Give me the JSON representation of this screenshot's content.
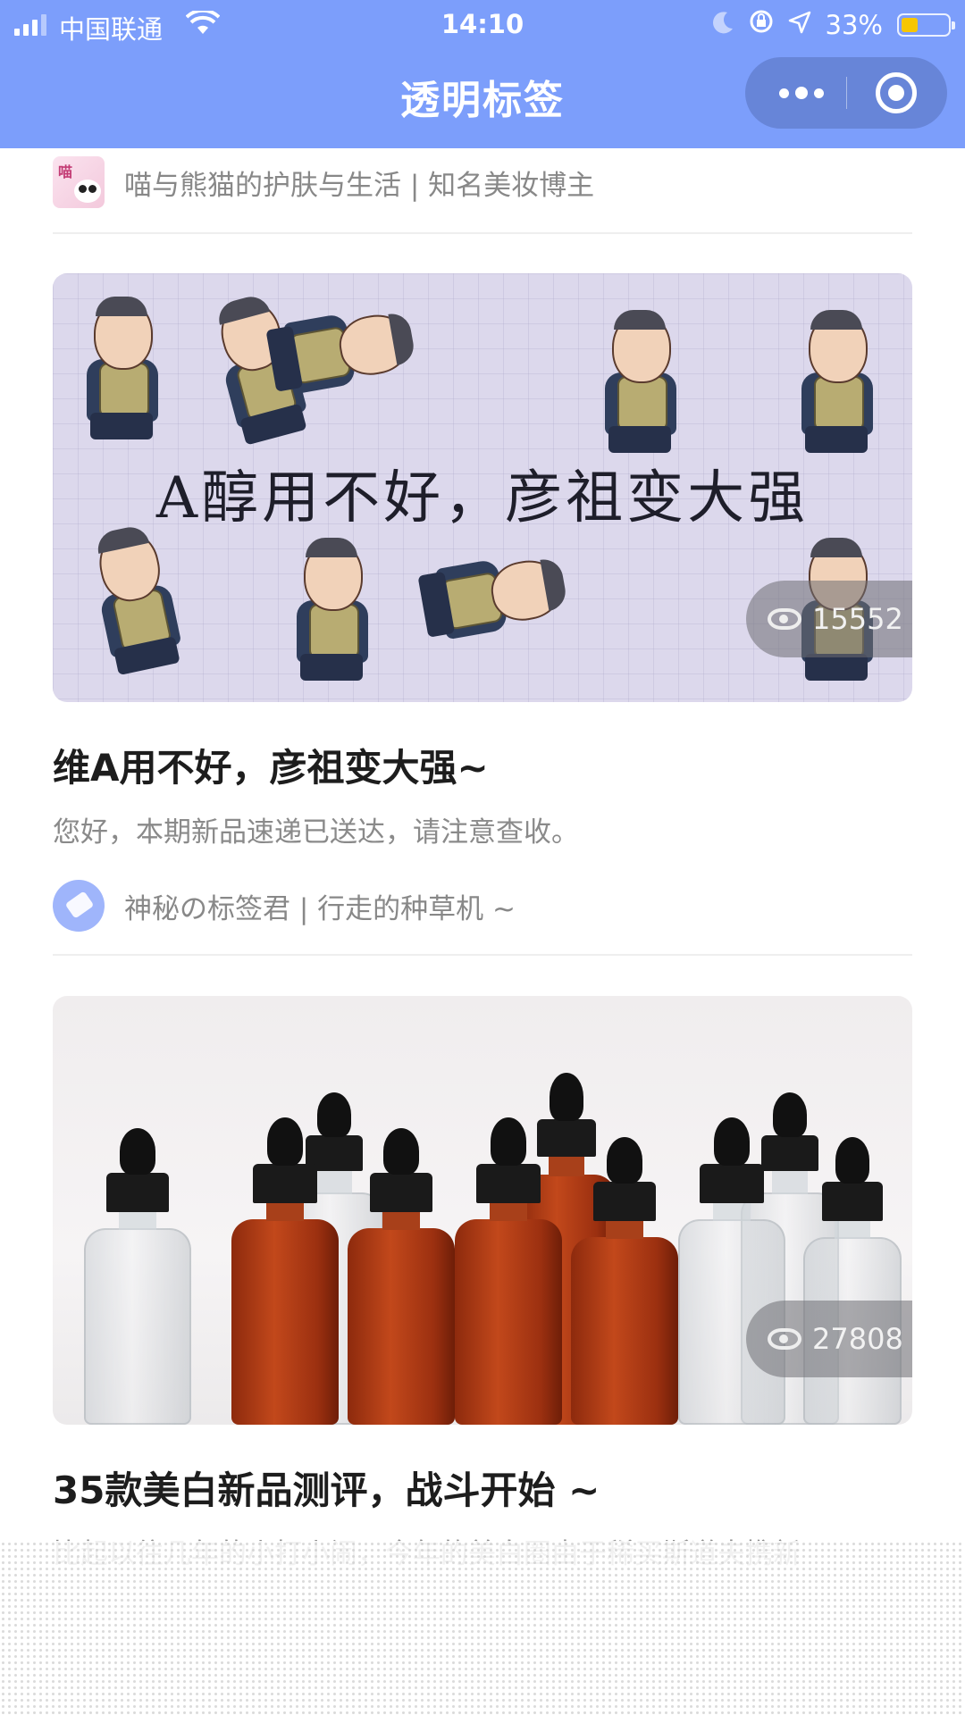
{
  "status_bar": {
    "carrier": "中国联通",
    "time": "14:10",
    "battery": "33%",
    "battery_level": 0.33
  },
  "nav": {
    "title": "透明标签"
  },
  "feed": {
    "top_author": {
      "name": "喵与熊猫的护肤与生活 | 知名美妆博主",
      "avatar_text": "喵"
    },
    "posts": [
      {
        "cover_caption": "A醇用不好，彦祖变大强",
        "views": "15552",
        "title": "维A用不好，彦祖变大强~",
        "summary": "您好，本期新品速递已送达，请注意查收。",
        "author": "神秘の标签君 | 行走的种草机 ~"
      },
      {
        "views": "27808",
        "title": "35款美白新品测评，战斗开始 ~",
        "summary": "比起以往几年的小打小闹，今年的美白圈由于稀买斯道夫携新"
      }
    ]
  },
  "colors": {
    "nav_bg": "#7c9efb",
    "battery_fill": "#f7c600"
  }
}
